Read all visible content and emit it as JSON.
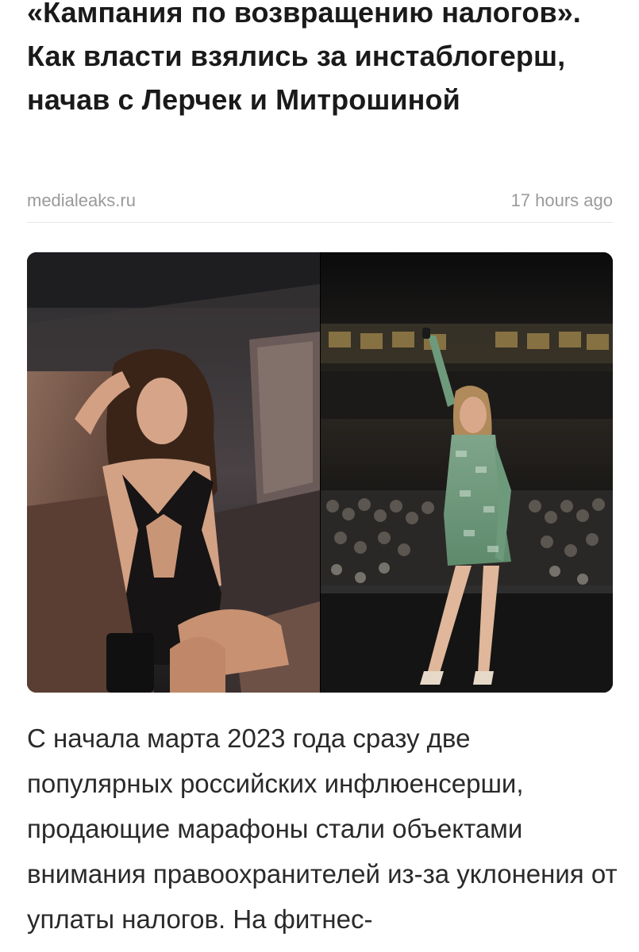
{
  "article": {
    "headline": "«Кампания по возвращению налогов». Как власти взялись за инстаблогерш, начав с Лерчек и Митрошиной",
    "source": "medialeaks.ru",
    "time": "17 hours ago",
    "lead": "С начала марта 2023 года сразу две популярных российских инфлюенсерши, продающие марафоны стали объектами внимания правоохранителей из-за уклонения от уплаты налогов. На фитнес-"
  }
}
